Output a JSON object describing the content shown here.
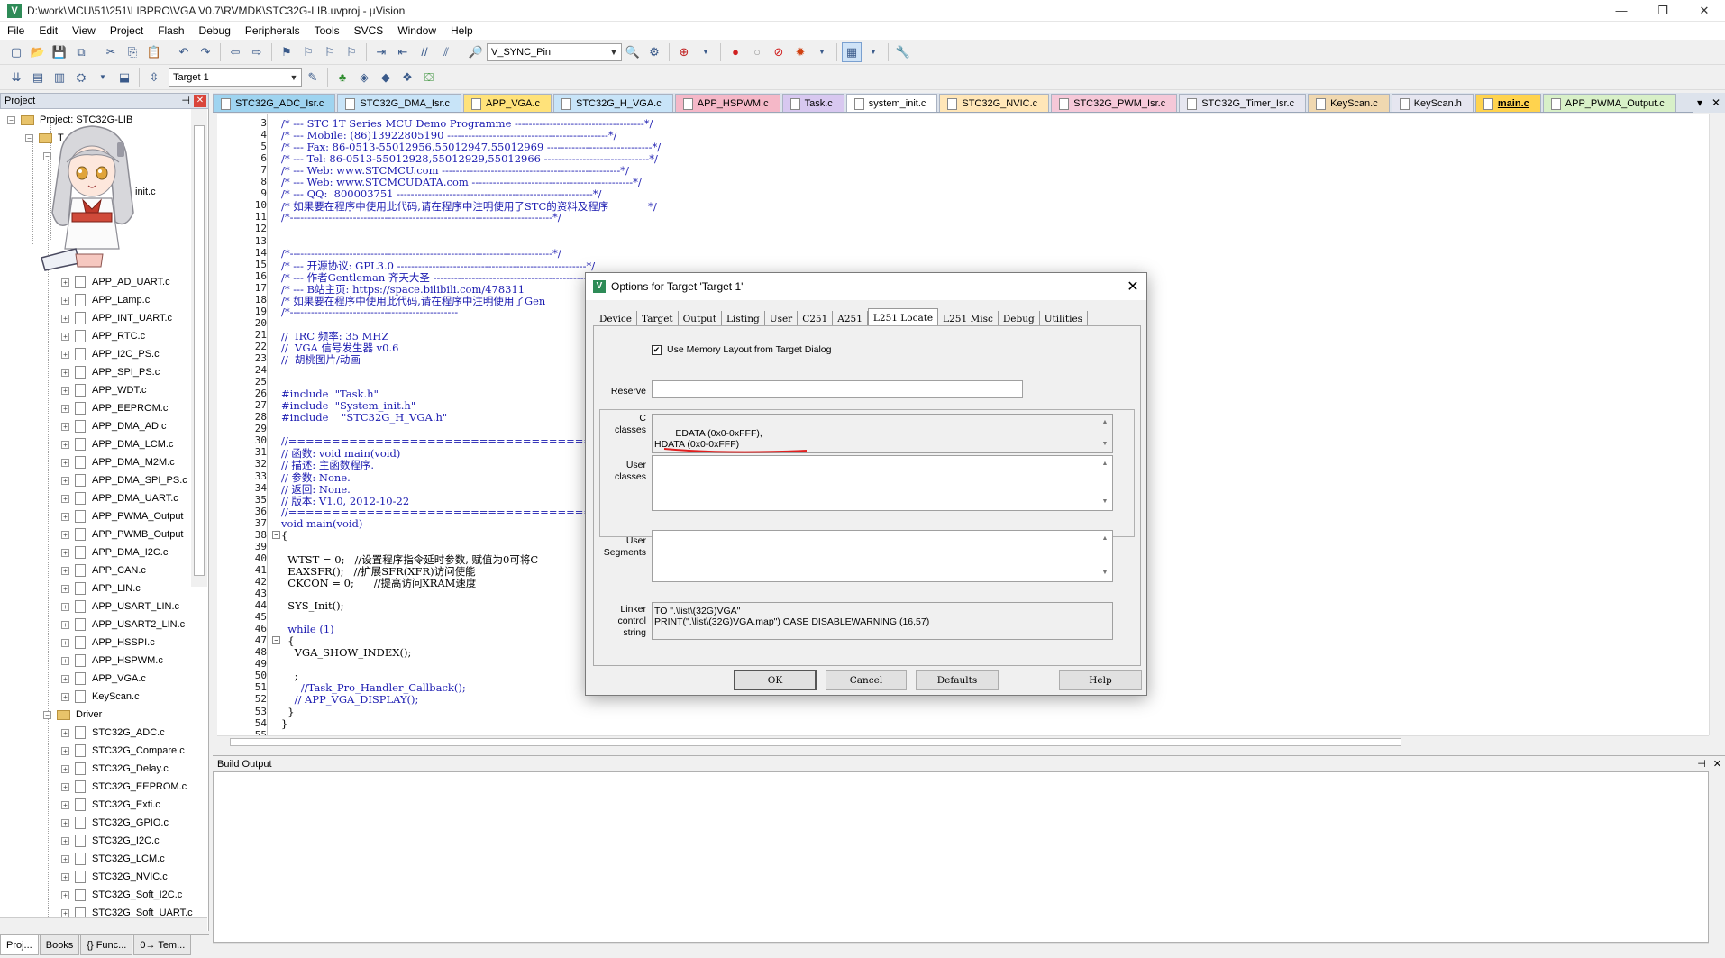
{
  "window": {
    "title": "D:\\work\\MCU\\51\\251\\LIBPRO\\VGA V0.7\\RVMDK\\STC32G-LIB.uvproj - µVision",
    "minimize": "—",
    "maximize": "❐",
    "close": "✕"
  },
  "menu": [
    "File",
    "Edit",
    "View",
    "Project",
    "Flash",
    "Debug",
    "Peripherals",
    "Tools",
    "SVCS",
    "Window",
    "Help"
  ],
  "toolbar1": {
    "find_combo": "V_SYNC_Pin"
  },
  "toolbar2": {
    "target_combo": "Target 1"
  },
  "project_panel": {
    "title": "Project",
    "project_label": "Project: STC32G-LIB",
    "partial_label": "T",
    "partial_file": "init.c",
    "app_files": [
      "APP_AD_UART.c",
      "APP_Lamp.c",
      "APP_INT_UART.c",
      "APP_RTC.c",
      "APP_I2C_PS.c",
      "APP_SPI_PS.c",
      "APP_WDT.c",
      "APP_EEPROM.c",
      "APP_DMA_AD.c",
      "APP_DMA_LCM.c",
      "APP_DMA_M2M.c",
      "APP_DMA_SPI_PS.c",
      "APP_DMA_UART.c",
      "APP_PWMA_Output",
      "APP_PWMB_Output",
      "APP_DMA_I2C.c",
      "APP_CAN.c",
      "APP_LIN.c",
      "APP_USART_LIN.c",
      "APP_USART2_LIN.c",
      "APP_HSSPI.c",
      "APP_HSPWM.c",
      "APP_VGA.c",
      "KeyScan.c"
    ],
    "driver_group": "Driver",
    "driver_files": [
      "STC32G_ADC.c",
      "STC32G_Compare.c",
      "STC32G_Delay.c",
      "STC32G_EEPROM.c",
      "STC32G_Exti.c",
      "STC32G_GPIO.c",
      "STC32G_I2C.c",
      "STC32G_LCM.c",
      "STC32G_NVIC.c",
      "STC32G_Soft_I2C.c",
      "STC32G_Soft_UART.c"
    ],
    "tabs": [
      "Proj...",
      "Books",
      "{} Func...",
      "0→ Tem..."
    ]
  },
  "editor_tabs": [
    {
      "label": "STC32G_ADC_Isr.c",
      "color": "#9fd4f0"
    },
    {
      "label": "STC32G_DMA_Isr.c",
      "color": "#c8e4f8"
    },
    {
      "label": "APP_VGA.c",
      "color": "#ffe27a"
    },
    {
      "label": "STC32G_H_VGA.c",
      "color": "#c8e4f8"
    },
    {
      "label": "APP_HSPWM.c",
      "color": "#f5b8c8"
    },
    {
      "label": "Task.c",
      "color": "#d8c8f0"
    },
    {
      "label": "system_init.c",
      "color": "#ffffff"
    },
    {
      "label": "STC32G_NVIC.c",
      "color": "#ffe6b8"
    },
    {
      "label": "STC32G_PWM_Isr.c",
      "color": "#f5c8d8"
    },
    {
      "label": "STC32G_Timer_Isr.c",
      "color": "#e6e6f0"
    },
    {
      "label": "KeyScan.c",
      "color": "#f0d8b0"
    },
    {
      "label": "KeyScan.h",
      "color": "#e6e6f0"
    },
    {
      "label": "main.c",
      "color": "#ffd34e",
      "active": true
    },
    {
      "label": "APP_PWMA_Output.c",
      "color": "#d8f0c8"
    }
  ],
  "code_lines": [
    {
      "n": "3",
      "t": "/* --- STC 1T Series MCU Demo Programme -------------------------------------*/",
      "c": "cmt"
    },
    {
      "n": "4",
      "t": "/* --- Mobile: (86)13922805190 ----------------------------------------------*/",
      "c": "cmt"
    },
    {
      "n": "5",
      "t": "/* --- Fax: 86-0513-55012956,55012947,55012969 ------------------------------*/",
      "c": "cmt"
    },
    {
      "n": "6",
      "t": "/* --- Tel: 86-0513-55012928,55012929,55012966 ------------------------------*/",
      "c": "cmt"
    },
    {
      "n": "7",
      "t": "/* --- Web: www.STCMCU.com ---------------------------------------------------*/",
      "c": "cmt"
    },
    {
      "n": "8",
      "t": "/* --- Web: www.STCMCUDATA.com ----------------------------------------------*/",
      "c": "cmt"
    },
    {
      "n": "9",
      "t": "/* --- QQ:  800003751 --------------------------------------------------------*/",
      "c": "cmt"
    },
    {
      "n": "10",
      "t": "/* 如果要在程序中使用此代码,请在程序中注明使用了STC的资料及程序            */",
      "c": "cmt"
    },
    {
      "n": "11",
      "t": "/*---------------------------------------------------------------------------*/",
      "c": "cmt"
    },
    {
      "n": "12",
      "t": "",
      "c": ""
    },
    {
      "n": "13",
      "t": "",
      "c": ""
    },
    {
      "n": "14",
      "t": "/*---------------------------------------------------------------------------*/",
      "c": "cmt"
    },
    {
      "n": "15",
      "t": "/* --- 开源协议: GPL3.0 ------------------------------------------------------*/",
      "c": "cmt"
    },
    {
      "n": "16",
      "t": "/* --- 作者Gentleman 齐天大圣 ------------------------------------------------*/",
      "c": "cmt"
    },
    {
      "n": "17",
      "t": "/* --- B站主页: https://space.bilibili.com/478311",
      "c": "cmt"
    },
    {
      "n": "18",
      "t": "/* 如果要在程序中使用此代码,请在程序中注明使用了Gen",
      "c": "cmt"
    },
    {
      "n": "19",
      "t": "/*------------------------------------------------",
      "c": "cmt"
    },
    {
      "n": "20",
      "t": "",
      "c": ""
    },
    {
      "n": "21",
      "t": "//  IRC 频率: 35 MHZ",
      "c": "cmt"
    },
    {
      "n": "22",
      "t": "//  VGA 信号发生器 v0.6",
      "c": "cmt"
    },
    {
      "n": "23",
      "t": "//  胡桃图片/动画",
      "c": "cmt"
    },
    {
      "n": "24",
      "t": "",
      "c": ""
    },
    {
      "n": "25",
      "t": "",
      "c": ""
    },
    {
      "n": "26",
      "t": "#include  \"Task.h\"",
      "c": "pp"
    },
    {
      "n": "27",
      "t": "#include  \"System_init.h\"",
      "c": "pp"
    },
    {
      "n": "28",
      "t": "#include    \"STC32G_H_VGA.h\"",
      "c": "pp"
    },
    {
      "n": "29",
      "t": "",
      "c": ""
    },
    {
      "n": "30",
      "t": "//================================================",
      "c": "cmt"
    },
    {
      "n": "31",
      "t": "// 函数: void main(void)",
      "c": "cmt"
    },
    {
      "n": "32",
      "t": "// 描述: 主函数程序.",
      "c": "cmt"
    },
    {
      "n": "33",
      "t": "// 参数: None.",
      "c": "cmt"
    },
    {
      "n": "34",
      "t": "// 返回: None.",
      "c": "cmt"
    },
    {
      "n": "35",
      "t": "// 版本: V1.0, 2012-10-22",
      "c": "cmt"
    },
    {
      "n": "36",
      "t": "//================================================",
      "c": "cmt"
    },
    {
      "n": "37",
      "t": "void main(void)",
      "c": "kw"
    },
    {
      "n": "38",
      "t": "{",
      "c": ""
    },
    {
      "n": "39",
      "t": "",
      "c": ""
    },
    {
      "n": "40",
      "t": "  WTST = 0;   //设置程序指令延时参数, 赋值为0可将C",
      "c": ""
    },
    {
      "n": "41",
      "t": "  EAXSFR();   //扩展SFR(XFR)访问使能",
      "c": ""
    },
    {
      "n": "42",
      "t": "  CKCON = 0;      //提高访问XRAM速度",
      "c": ""
    },
    {
      "n": "43",
      "t": "",
      "c": ""
    },
    {
      "n": "44",
      "t": "  SYS_Init();",
      "c": ""
    },
    {
      "n": "45",
      "t": "",
      "c": ""
    },
    {
      "n": "46",
      "t": "  while (1)",
      "c": "kw"
    },
    {
      "n": "47",
      "t": "  {",
      "c": ""
    },
    {
      "n": "48",
      "t": "    VGA_SHOW_INDEX();",
      "c": ""
    },
    {
      "n": "49",
      "t": "",
      "c": ""
    },
    {
      "n": "50",
      "t": "    ;",
      "c": ""
    },
    {
      "n": "51",
      "t": "      //Task_Pro_Handler_Callback();",
      "c": "cmt"
    },
    {
      "n": "52",
      "t": "    // APP_VGA_DISPLAY();",
      "c": "cmt"
    },
    {
      "n": "53",
      "t": "  }",
      "c": ""
    },
    {
      "n": "54",
      "t": "}",
      "c": ""
    },
    {
      "n": "55",
      "t": "",
      "c": ""
    }
  ],
  "build_output": {
    "title": "Build Output"
  },
  "dialog": {
    "title": "Options for Target 'Target 1'",
    "tabs": [
      "Device",
      "Target",
      "Output",
      "Listing",
      "User",
      "C251",
      "A251",
      "L251 Locate",
      "L251 Misc",
      "Debug",
      "Utilities"
    ],
    "active_tab": "L251 Locate",
    "use_memory_layout": "Use Memory Layout from Target Dialog",
    "reserve_label": "Reserve",
    "reserve_value": "",
    "c_classes_label": "C\nclasses",
    "c_classes_value": "EDATA (0x0-0xFFF),\nHDATA (0x0-0xFFF)",
    "user_classes_label": "User\nclasses",
    "user_classes_value": "",
    "user_segments_label": "User\nSegments",
    "user_segments_value": "",
    "linker_label": "Linker\ncontrol\nstring",
    "linker_value": "TO \".\\list\\(32G)VGA\"\nPRINT(\".\\list\\(32G)VGA.map\") CASE DISABLEWARNING (16,57)",
    "buttons": {
      "ok": "OK",
      "cancel": "Cancel",
      "defaults": "Defaults",
      "help": "Help"
    }
  },
  "colors": {
    "accent_tab": "#ffd34e",
    "annotation": "#e02020",
    "comment": "#1a1ab0",
    "string": "#9b1c1c"
  }
}
